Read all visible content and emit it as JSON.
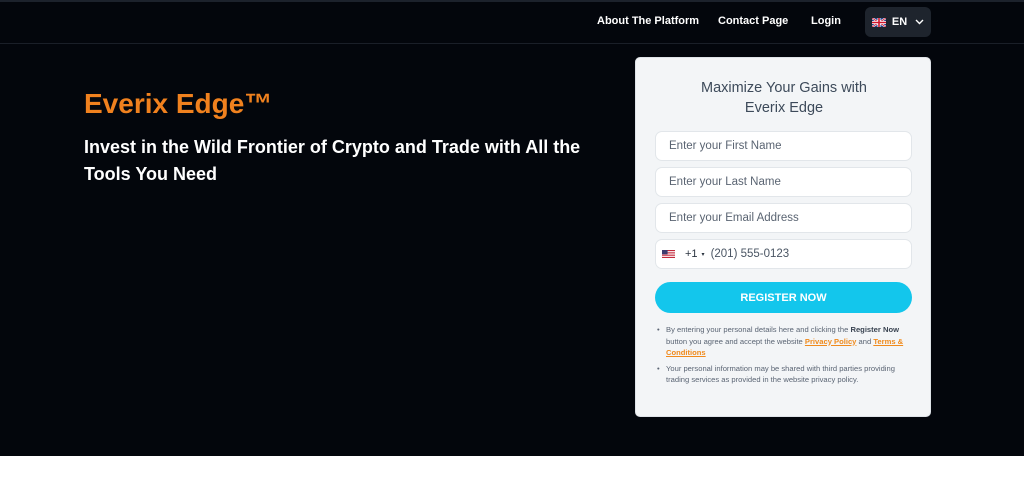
{
  "nav": {
    "about": "About The Platform",
    "contact": "Contact Page",
    "login": "Login",
    "language": {
      "code": "EN",
      "flag_icon": "uk-flag-icon",
      "chevron_icon": "chevron-down-icon"
    }
  },
  "hero": {
    "brand": "Everix Edge™",
    "headline": "Invest in the Wild Frontier of Crypto and Trade with All the Tools You Need"
  },
  "form": {
    "title_line1": "Maximize Your Gains with",
    "title_line2": "Everix Edge",
    "first_name_placeholder": "Enter your First Name",
    "last_name_placeholder": "Enter your Last Name",
    "email_placeholder": "Enter your Email Address",
    "phone": {
      "country_flag_icon": "us-flag-icon",
      "country_code": "+1",
      "caret": "▾",
      "placeholder": "(201) 555-0123"
    },
    "register_label": "REGISTER NOW",
    "disclaimer": {
      "p1_a": "By entering your personal details here and clicking the ",
      "p1_bold": "Register Now",
      "p1_b": " button you agree and accept the website ",
      "privacy_link": "Privacy Policy",
      "p1_and": " and ",
      "terms_link": "Terms & Conditions",
      "p2": "Your personal information may be shared with third parties providing trading services as provided in the website privacy policy."
    }
  },
  "colors": {
    "hero_bg": "#03060c",
    "brand": "#f0811e",
    "button": "#13c6ec",
    "link": "#f08a1c"
  }
}
